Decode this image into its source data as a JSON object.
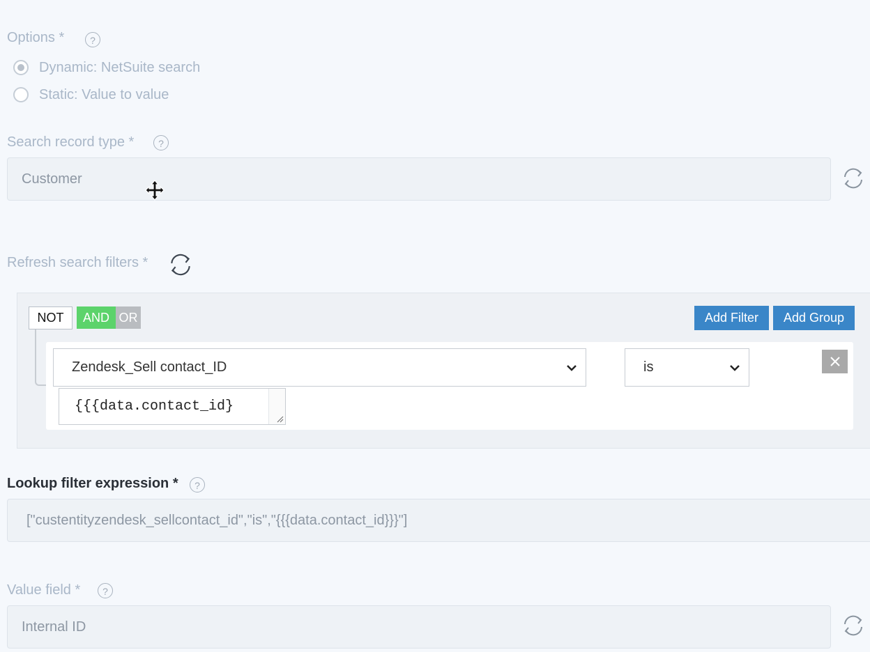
{
  "options": {
    "label": "Options *",
    "radios": [
      {
        "label": "Dynamic: NetSuite search",
        "checked": true
      },
      {
        "label": "Static: Value to value",
        "checked": false
      }
    ]
  },
  "search_record_type": {
    "label": "Search record type *",
    "value": "Customer"
  },
  "refresh_filters": {
    "label": "Refresh search filters *"
  },
  "filter_builder": {
    "not_label": "NOT",
    "and_label": "AND",
    "or_label": "OR",
    "add_filter_label": "Add Filter",
    "add_group_label": "Add Group",
    "rule": {
      "field": "Zendesk_Sell contact_ID",
      "operator": "is",
      "value": "{{{data.contact_id}"
    }
  },
  "lookup_filter": {
    "label": "Lookup filter expression *",
    "value": "[\"custentityzendesk_sellcontact_id\",\"is\",\"{{{data.contact_id}}}\"]"
  },
  "value_field": {
    "label": "Value field *",
    "value": "Internal ID"
  },
  "help_glyph": "?",
  "icons": [
    "help-icon",
    "refresh-icon",
    "chevron-down-icon",
    "close-icon",
    "move-cursor-icon"
  ],
  "colors": {
    "accent_blue": "#3a86c8",
    "and_green": "#5cd36b",
    "or_gray": "#b9bcc0",
    "muted_label": "#a9b7c8"
  }
}
